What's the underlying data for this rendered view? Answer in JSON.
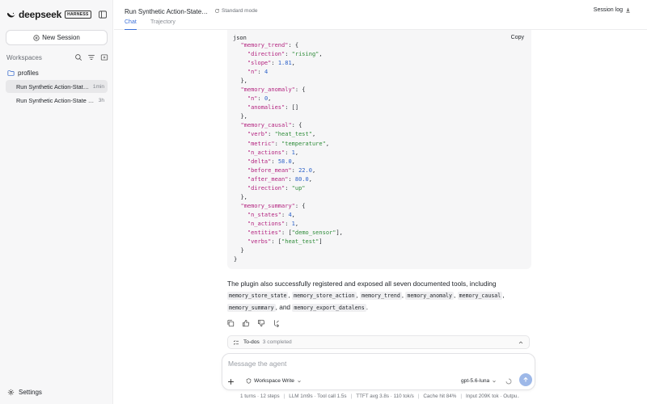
{
  "sidebar": {
    "brand": "deepseek",
    "brand_badge": "HARNESS",
    "new_session_label": "New Session",
    "workspaces_label": "Workspaces",
    "folder_label": "profiles",
    "sessions": [
      {
        "title": "Run Synthetic Action-State M...",
        "age": "1min",
        "active": true
      },
      {
        "title": "Run Synthetic Action-State M...",
        "age": "3h",
        "active": false
      }
    ],
    "settings_label": "Settings"
  },
  "header": {
    "title": "Run Synthetic Action-State Me...",
    "mode": "Standard mode",
    "tabs": [
      {
        "label": "Chat",
        "active": true
      },
      {
        "label": "Trajectory",
        "active": false
      }
    ],
    "session_log_label": "Session log"
  },
  "code_block": {
    "language": "json",
    "copy_label": "Copy",
    "lines": [
      {
        "i": 1,
        "t": [
          [
            "k",
            "\"memory_trend\""
          ],
          [
            "p",
            ": {"
          ]
        ]
      },
      {
        "i": 2,
        "t": [
          [
            "k",
            "\"direction\""
          ],
          [
            "p",
            ": "
          ],
          [
            "s",
            "\"rising\""
          ],
          [
            "p",
            ","
          ]
        ]
      },
      {
        "i": 2,
        "t": [
          [
            "k",
            "\"slope\""
          ],
          [
            "p",
            ": "
          ],
          [
            "n",
            "1.81"
          ],
          [
            "p",
            ","
          ]
        ]
      },
      {
        "i": 2,
        "t": [
          [
            "k",
            "\"n\""
          ],
          [
            "p",
            ": "
          ],
          [
            "n",
            "4"
          ]
        ]
      },
      {
        "i": 1,
        "t": [
          [
            "p",
            "},"
          ]
        ]
      },
      {
        "i": 1,
        "t": [
          [
            "k",
            "\"memory_anomaly\""
          ],
          [
            "p",
            ": {"
          ]
        ]
      },
      {
        "i": 2,
        "t": [
          [
            "k",
            "\"n\""
          ],
          [
            "p",
            ": "
          ],
          [
            "n",
            "0"
          ],
          [
            "p",
            ","
          ]
        ]
      },
      {
        "i": 2,
        "t": [
          [
            "k",
            "\"anomalies\""
          ],
          [
            "p",
            ": []"
          ]
        ]
      },
      {
        "i": 1,
        "t": [
          [
            "p",
            "},"
          ]
        ]
      },
      {
        "i": 1,
        "t": [
          [
            "k",
            "\"memory_causal\""
          ],
          [
            "p",
            ": {"
          ]
        ]
      },
      {
        "i": 2,
        "t": [
          [
            "k",
            "\"verb\""
          ],
          [
            "p",
            ": "
          ],
          [
            "s",
            "\"heat_test\""
          ],
          [
            "p",
            ","
          ]
        ]
      },
      {
        "i": 2,
        "t": [
          [
            "k",
            "\"metric\""
          ],
          [
            "p",
            ": "
          ],
          [
            "s",
            "\"temperature\""
          ],
          [
            "p",
            ","
          ]
        ]
      },
      {
        "i": 2,
        "t": [
          [
            "k",
            "\"n_actions\""
          ],
          [
            "p",
            ": "
          ],
          [
            "n",
            "1"
          ],
          [
            "p",
            ","
          ]
        ]
      },
      {
        "i": 2,
        "t": [
          [
            "k",
            "\"delta\""
          ],
          [
            "p",
            ": "
          ],
          [
            "n",
            "58.0"
          ],
          [
            "p",
            ","
          ]
        ]
      },
      {
        "i": 2,
        "t": [
          [
            "k",
            "\"before_mean\""
          ],
          [
            "p",
            ": "
          ],
          [
            "n",
            "22.0"
          ],
          [
            "p",
            ","
          ]
        ]
      },
      {
        "i": 2,
        "t": [
          [
            "k",
            "\"after_mean\""
          ],
          [
            "p",
            ": "
          ],
          [
            "n",
            "80.0"
          ],
          [
            "p",
            ","
          ]
        ]
      },
      {
        "i": 2,
        "t": [
          [
            "k",
            "\"direction\""
          ],
          [
            "p",
            ": "
          ],
          [
            "s",
            "\"up\""
          ]
        ]
      },
      {
        "i": 1,
        "t": [
          [
            "p",
            "},"
          ]
        ]
      },
      {
        "i": 1,
        "t": [
          [
            "k",
            "\"memory_summary\""
          ],
          [
            "p",
            ": {"
          ]
        ]
      },
      {
        "i": 2,
        "t": [
          [
            "k",
            "\"n_states\""
          ],
          [
            "p",
            ": "
          ],
          [
            "n",
            "4"
          ],
          [
            "p",
            ","
          ]
        ]
      },
      {
        "i": 2,
        "t": [
          [
            "k",
            "\"n_actions\""
          ],
          [
            "p",
            ": "
          ],
          [
            "n",
            "1"
          ],
          [
            "p",
            ","
          ]
        ]
      },
      {
        "i": 2,
        "t": [
          [
            "k",
            "\"entities\""
          ],
          [
            "p",
            ": ["
          ],
          [
            "s",
            "\"demo_sensor\""
          ],
          [
            "p",
            "],"
          ]
        ]
      },
      {
        "i": 2,
        "t": [
          [
            "k",
            "\"verbs\""
          ],
          [
            "p",
            ": ["
          ],
          [
            "s",
            "\"heat_test\""
          ],
          [
            "p",
            "]"
          ]
        ]
      },
      {
        "i": 1,
        "t": [
          [
            "p",
            "}"
          ]
        ]
      },
      {
        "i": 0,
        "t": [
          [
            "p",
            "}"
          ]
        ]
      }
    ]
  },
  "message": {
    "intro": "The plugin also successfully registered and exposed all seven documented tools, including",
    "tools": [
      "memory_store_state",
      "memory_store_action",
      "memory_trend",
      "memory_anomaly",
      "memory_causal",
      "memory_summary",
      "memory_export_datalens"
    ],
    "and_word": "and"
  },
  "todos": {
    "label": "To-dos",
    "count": "3 completed"
  },
  "composer": {
    "placeholder": "Message the agent",
    "value": "",
    "workspace_mode": "Workspace Write",
    "model": "gpt-5.6-luna"
  },
  "status_bar": [
    "1 turns · 12 steps",
    "LLM 1m9s · Tool call 1.5s",
    "TTFT avg 3.8s · 110 tok/s",
    "Cache hit 84%",
    "Input 209K tok · Outpu..."
  ]
}
